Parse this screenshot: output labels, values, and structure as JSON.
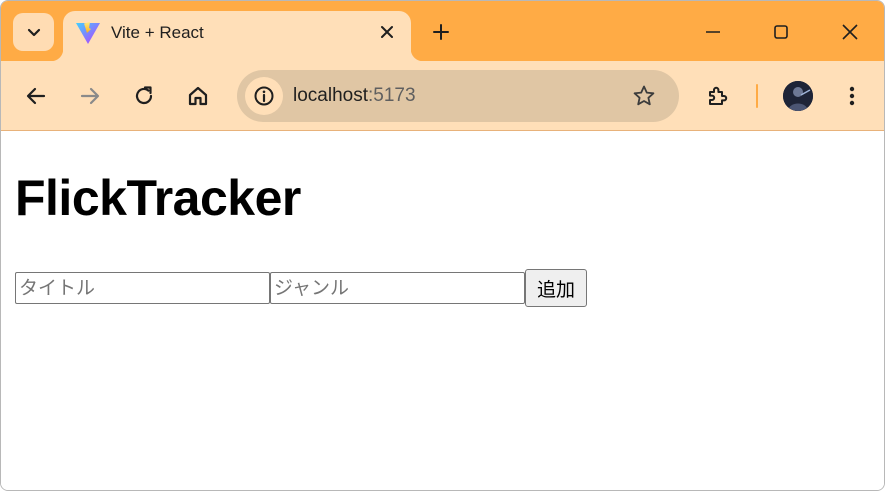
{
  "browser": {
    "tab": {
      "title": "Vite + React"
    },
    "address": {
      "host": "localhost",
      "port": ":5173"
    }
  },
  "page": {
    "heading": "FlickTracker",
    "form": {
      "title_placeholder": "タイトル",
      "genre_placeholder": "ジャンル",
      "add_label": "追加"
    }
  },
  "colors": {
    "tabstrip": "#ffab45",
    "toolbar": "#ffdfb8",
    "omnibox": "#e0c6a4"
  },
  "icons": [
    "chevron-down-icon",
    "vite-logo-icon",
    "close-icon",
    "plus-icon",
    "minimize-icon",
    "maximize-icon",
    "back-arrow-icon",
    "forward-arrow-icon",
    "reload-icon",
    "home-icon",
    "info-icon",
    "star-icon",
    "extensions-icon",
    "more-vert-icon"
  ]
}
